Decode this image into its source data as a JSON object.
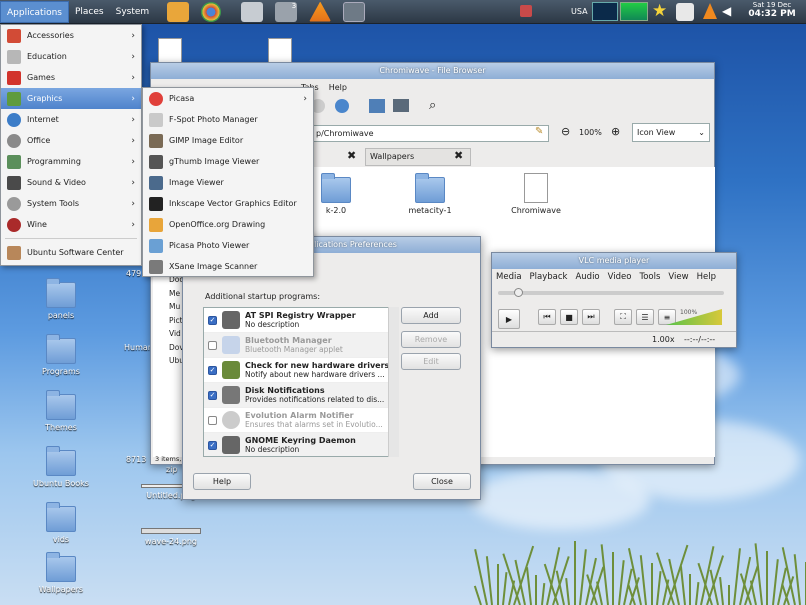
{
  "top_panel": {
    "menus": [
      "Applications",
      "Places",
      "System"
    ],
    "tray": {
      "keyboard": "USA",
      "date": "Sat 19 Dec",
      "time": "04:32 PM"
    },
    "badge": "3"
  },
  "desktop": {
    "icons": [
      "panels",
      "Programs",
      "Themes",
      "Ubuntu Books",
      "vids",
      "Wallpapers"
    ],
    "files": [
      "Untitled.png",
      "wave-24.png"
    ],
    "partial_labels": [
      "479",
      "Human",
      "8713",
      "zip"
    ]
  },
  "app_menu": {
    "items": [
      {
        "label": "Accessories",
        "color": "#d24b36"
      },
      {
        "label": "Education",
        "color": "#b7b7b7"
      },
      {
        "label": "Games",
        "color": "#d2342c"
      },
      {
        "label": "Graphics",
        "color": "#5f9b3e"
      },
      {
        "label": "Internet",
        "color": "#3c7dc8"
      },
      {
        "label": "Office",
        "color": "#8a8a8a"
      },
      {
        "label": "Programming",
        "color": "#5b8f5b"
      },
      {
        "label": "Sound & Video",
        "color": "#4a4a4a"
      },
      {
        "label": "System Tools",
        "color": "#9a9a9a"
      },
      {
        "label": "Wine",
        "color": "#aa2a2a"
      }
    ],
    "software_center": "Ubuntu Software Center"
  },
  "graphics_submenu": {
    "items": [
      {
        "label": "Picasa",
        "color": "#e0403a",
        "arrow": true
      },
      {
        "label": "F-Spot Photo Manager",
        "color": "#c9c9c9"
      },
      {
        "label": "GIMP Image Editor",
        "color": "#7a6a55"
      },
      {
        "label": "gThumb Image Viewer",
        "color": "#555555"
      },
      {
        "label": "Image Viewer",
        "color": "#4b6a8c"
      },
      {
        "label": "Inkscape Vector Graphics Editor",
        "color": "#222222"
      },
      {
        "label": "OpenOffice.org Drawing",
        "color": "#e8a53a"
      },
      {
        "label": "Picasa Photo Viewer",
        "color": "#6aa0d4"
      },
      {
        "label": "XSane Image Scanner",
        "color": "#7a7a7a"
      }
    ]
  },
  "file_browser": {
    "title": "Chromiwave - File Browser",
    "menu_help": "Help",
    "menu_tabs": "Tabs",
    "location": "p/Chromiwave",
    "zoom": "100%",
    "view_mode": "Icon View",
    "tab": "Wallpapers",
    "files": [
      "k-2.0",
      "metacity-1",
      "Chromiwave"
    ],
    "sidebar": [
      "Doc",
      "Me",
      "Mu",
      "Pict",
      "Vid",
      "Dov",
      "Ubu"
    ],
    "status": "3 items, Fre"
  },
  "vlc": {
    "title": "VLC media player",
    "menus": [
      "Media",
      "Playback",
      "Audio",
      "Video",
      "Tools",
      "View",
      "Help"
    ],
    "speed": "1.00x",
    "time": "--:--/--:--",
    "volume": "100%",
    "volume_level": 1.0
  },
  "prefs": {
    "title": "plications Preferences",
    "section": "Additional startup programs:",
    "programs": [
      {
        "name": "AT SPI Registry Wrapper",
        "desc": "No description",
        "checked": true,
        "dim": false,
        "color": "#666666"
      },
      {
        "name": "Bluetooth Manager",
        "desc": "Bluetooth Manager applet",
        "checked": false,
        "dim": true,
        "color": "#c6d4ea"
      },
      {
        "name": "Check for new hardware drivers",
        "desc": "Notify about new hardware drivers ...",
        "checked": true,
        "dim": false,
        "color": "#6a8a3a"
      },
      {
        "name": "Disk Notifications",
        "desc": "Provides notifications related to dis...",
        "checked": true,
        "dim": false,
        "color": "#777777"
      },
      {
        "name": "Evolution Alarm Notifier",
        "desc": "Ensures that alarms set in Evolutio...",
        "checked": false,
        "dim": true,
        "color": "#cccccc"
      },
      {
        "name": "GNOME Keyring Daemon",
        "desc": "No description",
        "checked": true,
        "dim": false,
        "color": "#666666"
      }
    ],
    "buttons": {
      "add": "Add",
      "remove": "Remove",
      "edit": "Edit",
      "help": "Help",
      "close": "Close"
    }
  }
}
